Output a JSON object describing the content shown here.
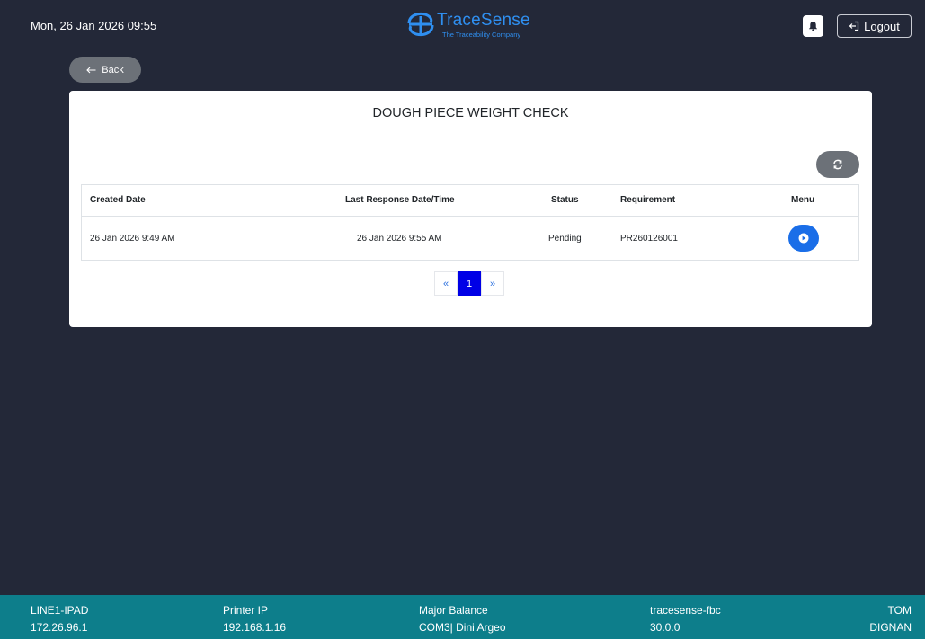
{
  "header": {
    "datetime": "Mon, 26 Jan 2026 09:55",
    "logo_name": "TraceSense",
    "logo_tagline": "The Traceability Company",
    "logout_label": "Logout"
  },
  "back_label": "Back",
  "card": {
    "title": "DOUGH PIECE WEIGHT CHECK"
  },
  "table": {
    "headers": {
      "created": "Created Date",
      "last_response": "Last Response Date/Time",
      "status": "Status",
      "requirement": "Requirement",
      "menu": "Menu"
    },
    "rows": [
      {
        "created": "26 Jan 2026 9:49 AM",
        "last_response": "26 Jan 2026 9:55 AM",
        "status": "Pending",
        "requirement": "PR260126001"
      }
    ]
  },
  "pagination": {
    "prev": "«",
    "current": "1",
    "next": "»"
  },
  "footer": {
    "device_label": "LINE1-IPAD",
    "device_ip": "172.26.96.1",
    "printer_label": "Printer IP",
    "printer_ip": "192.168.1.16",
    "balance_label": "Major Balance",
    "balance_value": "COM3| Dini Argeo",
    "app_name": "tracesense-fbc",
    "app_version": "30.0.0",
    "user_first": "TOM",
    "user_last": "DIGNAN"
  },
  "colors": {
    "background": "#232838",
    "brand": "#2f8ff0",
    "footer": "#0d7e8b",
    "primary_button": "#1a6ee8",
    "secondary_button": "#6c7178",
    "active_page": "#0000e6"
  },
  "icons": {
    "bell": "bell-icon",
    "logout": "logout-icon",
    "back": "arrow-left-icon",
    "refresh": "refresh-icon",
    "play": "play-icon"
  }
}
